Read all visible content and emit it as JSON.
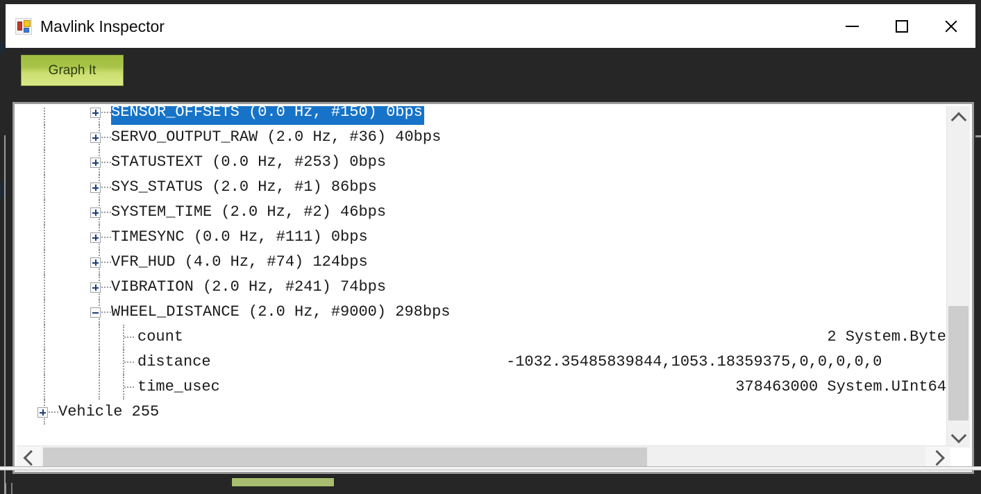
{
  "window": {
    "title": "Mavlink Inspector",
    "icon": "form-designer-icon",
    "controls": {
      "minimize": "minimize-icon",
      "maximize": "maximize-icon",
      "close": "close-icon"
    }
  },
  "toolbar": {
    "graph_it_label": "Graph It",
    "graph_it_color": "#a9c549"
  },
  "colors": {
    "selection": "#1673c8",
    "window_background": "#262626",
    "panel_background": "#ffffff",
    "scrollbar_thumb": "#cdcdcd"
  },
  "tree": {
    "rows": [
      {
        "label": "SENSOR_OFFSETS (0.0 Hz, #150) 0bps",
        "level": 1,
        "expander": "plus",
        "selected": true,
        "value": ""
      },
      {
        "label": "SERVO_OUTPUT_RAW (2.0 Hz, #36) 40bps",
        "level": 1,
        "expander": "plus",
        "selected": false,
        "value": ""
      },
      {
        "label": "STATUSTEXT (0.0 Hz, #253) 0bps",
        "level": 1,
        "expander": "plus",
        "selected": false,
        "value": ""
      },
      {
        "label": "SYS_STATUS (2.0 Hz, #1) 86bps",
        "level": 1,
        "expander": "plus",
        "selected": false,
        "value": ""
      },
      {
        "label": "SYSTEM_TIME (2.0 Hz, #2) 46bps",
        "level": 1,
        "expander": "plus",
        "selected": false,
        "value": ""
      },
      {
        "label": "TIMESYNC (0.0 Hz, #111) 0bps",
        "level": 1,
        "expander": "plus",
        "selected": false,
        "value": ""
      },
      {
        "label": "VFR_HUD (4.0 Hz, #74) 124bps",
        "level": 1,
        "expander": "plus",
        "selected": false,
        "value": ""
      },
      {
        "label": "VIBRATION (2.0 Hz, #241) 74bps",
        "level": 1,
        "expander": "plus",
        "selected": false,
        "value": ""
      },
      {
        "label": "WHEEL_DISTANCE (2.0 Hz, #9000) 298bps",
        "level": 1,
        "expander": "minus",
        "selected": false,
        "value": ""
      },
      {
        "label": "count",
        "level": 2,
        "expander": "none",
        "selected": false,
        "value": "2 System.Byte"
      },
      {
        "label": "distance",
        "level": 2,
        "expander": "none",
        "selected": false,
        "value": "-1032.35485839844,1053.18359375,0,0,0,0,0"
      },
      {
        "label": "time_usec",
        "level": 2,
        "expander": "none",
        "selected": false,
        "value": "378463000 System.UInt64"
      },
      {
        "label": "Vehicle 255",
        "level": 0,
        "expander": "plus",
        "selected": false,
        "value": ""
      }
    ]
  },
  "scrollbars": {
    "vertical": {
      "up_icon": "chevron-up-icon",
      "down_icon": "chevron-down-icon"
    },
    "horizontal": {
      "left_icon": "chevron-left-icon",
      "right_icon": "chevron-right-icon"
    }
  }
}
